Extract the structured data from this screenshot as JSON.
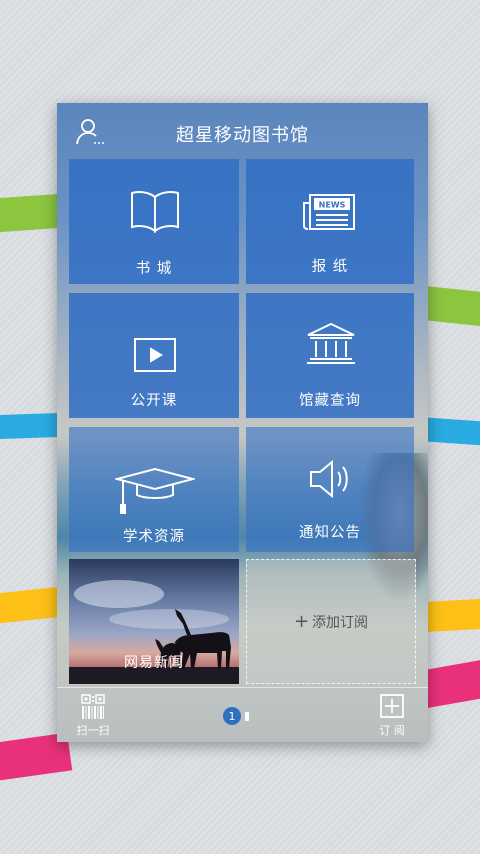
{
  "header": {
    "title": "超星移动图书馆"
  },
  "tiles": [
    {
      "label": "书 城",
      "icon": "book-icon"
    },
    {
      "label": "报 纸",
      "icon": "newspaper-icon",
      "icon_text": "NEWS"
    },
    {
      "label": "公开课",
      "icon": "video-play-icon"
    },
    {
      "label": "馆藏查询",
      "icon": "library-building-icon"
    },
    {
      "label": "学术资源",
      "icon": "graduation-cap-icon"
    },
    {
      "label": "通知公告",
      "icon": "speaker-icon"
    }
  ],
  "news_tile": {
    "label": "网易新闻"
  },
  "add_tile": {
    "label": "添加订阅",
    "icon_text": "+"
  },
  "bottom": {
    "scan_label": "扫一扫",
    "subscribe_label": "订 阅",
    "page_current": "1"
  },
  "colors": {
    "tile_blue": "#3370c4",
    "ribbon_green": "#8cc63f",
    "ribbon_blue": "#29abe2",
    "ribbon_yellow": "#fdc016",
    "ribbon_pink": "#e8317a",
    "page_dot": "#2f6fc2"
  }
}
